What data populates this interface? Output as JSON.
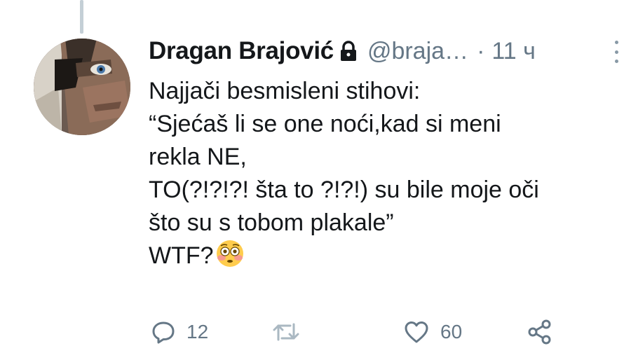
{
  "tweet": {
    "author_name": "Dragan Brajović",
    "handle": "@braja…",
    "separator": "·",
    "time": "11 ч",
    "lines": [
      "Najjači besmisleni stihovi:",
      "“Sjećaš li se one noći,kad si meni",
      "rekla NE,",
      "TO(?!?!?! šta to ?!?!) su bile moje oči",
      "što su s tobom plakale”",
      "WTF?"
    ],
    "emoji": "flushed-face-emoji"
  },
  "actions": {
    "reply_count": "12",
    "like_count": "60"
  },
  "icons": {
    "lock": "lock-icon",
    "more": "more-vertical-icon",
    "reply": "reply-icon",
    "retweet": "retweet-icon",
    "like": "heart-icon",
    "share": "share-icon"
  },
  "colors": {
    "text": "#14171a",
    "secondary": "#657786",
    "thread_line": "#c4cfd6"
  }
}
